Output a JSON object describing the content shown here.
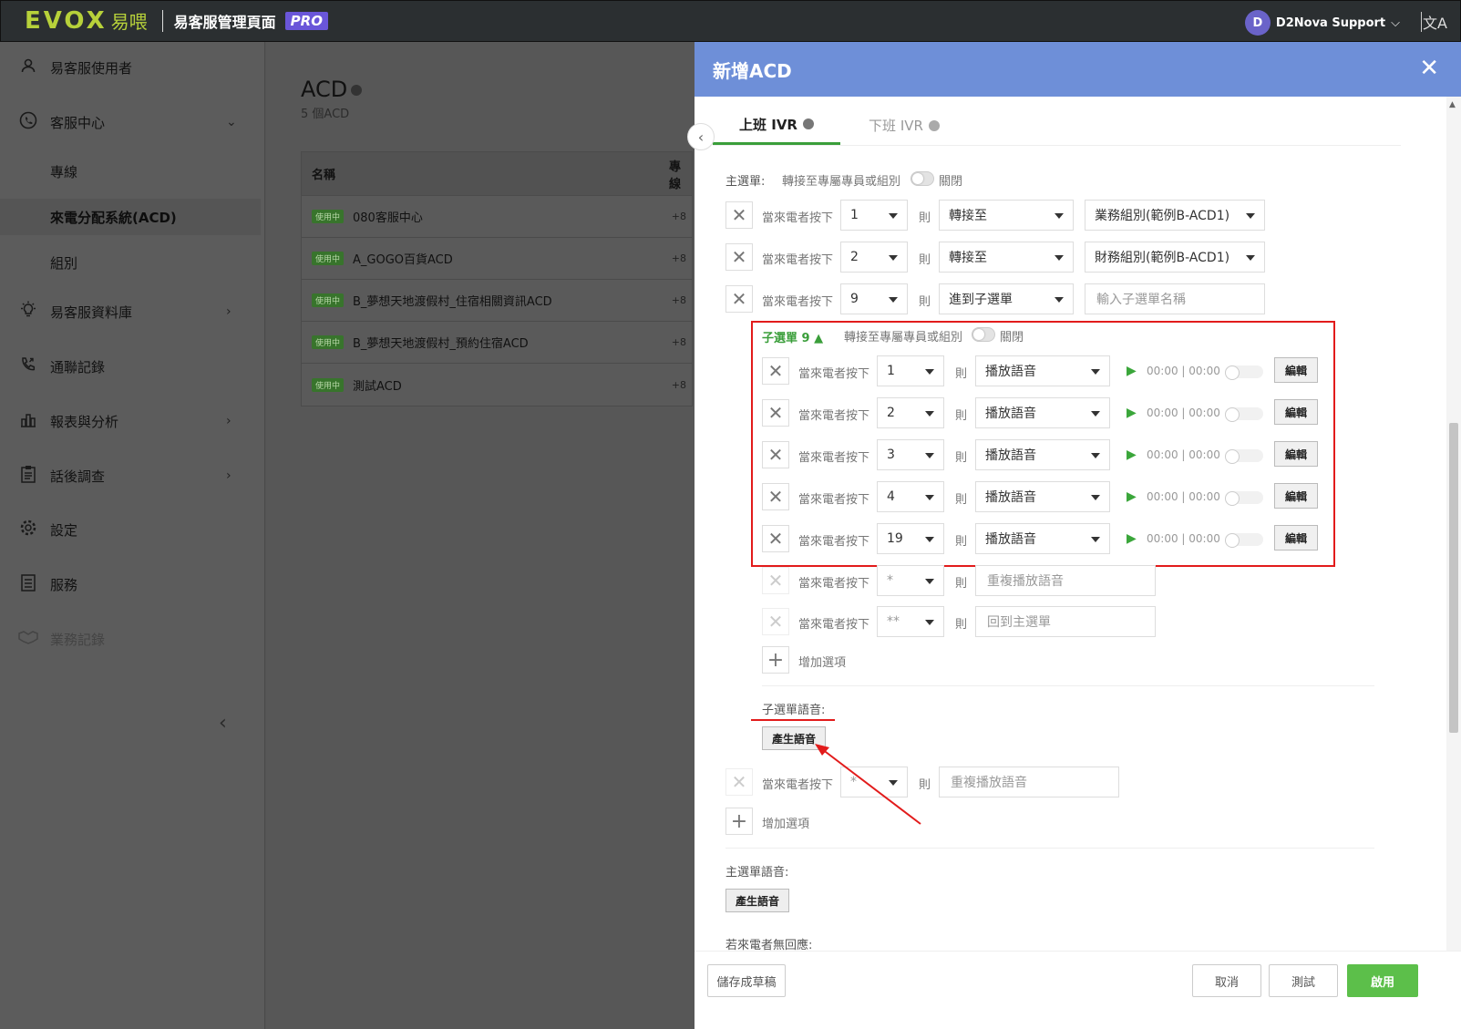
{
  "topbar": {
    "logo_latin": "EVOX",
    "logo_cn": "易喂",
    "app_title": "易客服管理頁面",
    "pro_badge": "PRO",
    "user_initial": "D",
    "user_name": "D2Nova Support",
    "user_caret": "⌵",
    "translate_icon": "文A"
  },
  "sidebar": {
    "items": [
      {
        "label": "易客服使用者",
        "icon": "user-icon"
      },
      {
        "label": "客服中心",
        "icon": "headset-icon",
        "arrow": "⌄"
      },
      {
        "label": "專線"
      },
      {
        "label": "來電分配系統(ACD)"
      },
      {
        "label": "組別"
      },
      {
        "label": "易客服資料庫",
        "icon": "bulb-icon",
        "arrow": "›"
      },
      {
        "label": "通聯記錄",
        "icon": "phone-icon"
      },
      {
        "label": "報表與分析",
        "icon": "chart-icon",
        "arrow": "›"
      },
      {
        "label": "話後調查",
        "icon": "survey-icon",
        "arrow": "›"
      },
      {
        "label": "設定",
        "icon": "gear-icon"
      },
      {
        "label": "服務",
        "icon": "service-icon"
      },
      {
        "label": "業務記錄",
        "icon": "handshake-icon"
      }
    ],
    "collapse": "‹"
  },
  "main": {
    "title": "ACD",
    "subtitle": "5 個ACD",
    "columns": [
      "名稱",
      "專線"
    ],
    "badge": "使用中",
    "rows": [
      {
        "name": "080客服中心",
        "line": "+8"
      },
      {
        "name": "A_GOGO百貨ACD",
        "line": "+8"
      },
      {
        "name": "B_夢想天地渡假村_住宿相關資訊ACD",
        "line": "+8"
      },
      {
        "name": "B_夢想天地渡假村_預約住宿ACD",
        "line": "+8"
      },
      {
        "name": "測試ACD",
        "line": "+8"
      }
    ]
  },
  "drawer": {
    "title": "新增ACD",
    "close": "✕",
    "back": "‹",
    "tabs": [
      {
        "label": "上班 IVR",
        "active": true
      },
      {
        "label": "下班 IVR",
        "active": false
      }
    ],
    "main_menu_label": "主選單:",
    "transfer_label": "轉接至專屬專員或組別",
    "off_label": "關閉",
    "press_label": "當來電者按下",
    "then_label": "則",
    "main_rows": [
      {
        "key": "1",
        "action": "轉接至",
        "target": "業務組別(範例B-ACD1)"
      },
      {
        "key": "2",
        "action": "轉接至",
        "target": "財務組別(範例B-ACD1)"
      },
      {
        "key": "9",
        "action": "進到子選單",
        "target_placeholder": "輸入子選單名稱"
      }
    ],
    "submenu_label": "子選單 9 ▲",
    "sub_rows": [
      {
        "key": "1",
        "action": "播放語音",
        "time": "00:00 | 00:00",
        "edit": "編輯"
      },
      {
        "key": "2",
        "action": "播放語音",
        "time": "00:00 | 00:00",
        "edit": "編輯"
      },
      {
        "key": "3",
        "action": "播放語音",
        "time": "00:00 | 00:00",
        "edit": "編輯"
      },
      {
        "key": "4",
        "action": "播放語音",
        "time": "00:00 | 00:00",
        "edit": "編輯"
      },
      {
        "key": "19",
        "action": "播放語音",
        "time": "00:00 | 00:00",
        "edit": "編輯"
      }
    ],
    "sub_fixed_rows": [
      {
        "key": "*",
        "action": "重複播放語音"
      },
      {
        "key": "**",
        "action": "回到主選單"
      }
    ],
    "add_option": "增加選項",
    "sub_voice_label": "子選單語音:",
    "generate_voice": "產生語音",
    "main_fixed_row": {
      "key": "*",
      "action": "重複播放語音"
    },
    "main_voice_label": "主選單語音:",
    "no_response_label": "若來電者無回應:",
    "footer": {
      "save_draft": "儲存成草稿",
      "cancel": "取消",
      "test": "測試",
      "enable": "啟用"
    }
  },
  "colors": {
    "accent_green": "#5cbf4a",
    "header_blue": "#6e8fd8",
    "annotation_red": "#e21b1b",
    "pro_purple": "#6a56d9"
  }
}
